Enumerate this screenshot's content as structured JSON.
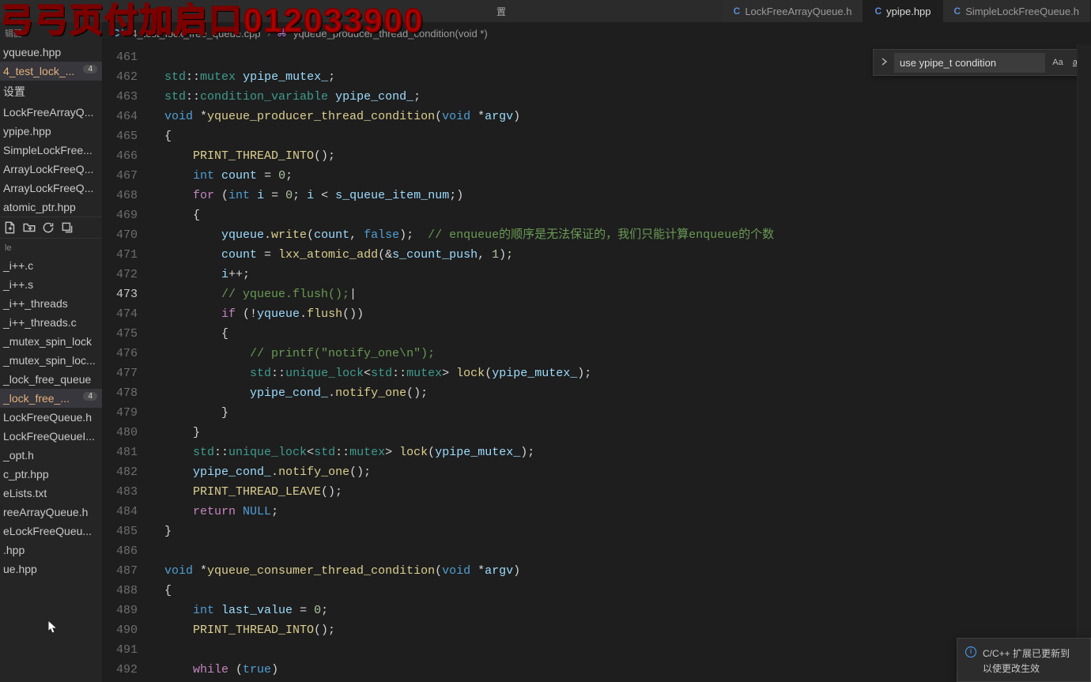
{
  "watermark": "弓弓页付加启口012033900",
  "menu": {
    "item_trimmed": "置"
  },
  "tabs": [
    {
      "lang": "C",
      "label": "LockFreeArrayQueue.h",
      "active": false
    },
    {
      "lang": "C",
      "label": "ypipe.hpp",
      "active": true
    },
    {
      "lang": "C",
      "label": "SimpleLockFreeQueue.h",
      "active": false
    }
  ],
  "breadcrumb": {
    "file_icon": "C⁺",
    "file": "4_test_lock_free_queue.cpp",
    "sep": "›",
    "sym_icon": "⌘",
    "symbol": "yqueue_producer_thread_condition(void *)"
  },
  "search": {
    "value": "use ypipe_t condition",
    "opt_case": "Aa",
    "opt_word": "ab"
  },
  "sidebar": {
    "section_open": "辑器",
    "open": [
      {
        "label": "yqueue.hpp"
      },
      {
        "label": "4_test_lock_...",
        "badge": "4",
        "active": true
      },
      {
        "label": "设置"
      },
      {
        "label": "LockFreeArrayQ..."
      },
      {
        "label": "ypipe.hpp"
      },
      {
        "label": "SimpleLockFree..."
      },
      {
        "label": "ArrayLockFreeQ..."
      },
      {
        "label": "ArrayLockFreeQ..."
      },
      {
        "label": "atomic_ptr.hpp"
      }
    ],
    "section_ws": "le",
    "ws": [
      {
        "label": "_i++.c"
      },
      {
        "label": "_i++.s"
      },
      {
        "label": "_i++_threads"
      },
      {
        "label": "_i++_threads.c"
      },
      {
        "label": "_mutex_spin_lock"
      },
      {
        "label": "_mutex_spin_loc..."
      },
      {
        "label": "_lock_free_queue"
      },
      {
        "label": "_lock_free_...",
        "badge": "4",
        "active": true
      },
      {
        "label": "LockFreeQueue.h"
      },
      {
        "label": "LockFreeQueueI..."
      },
      {
        "label": "_opt.h"
      },
      {
        "label": "c_ptr.hpp"
      },
      {
        "label": "eLists.txt"
      },
      {
        "label": "reeArrayQueue.h"
      },
      {
        "label": "eLockFreeQueu..."
      },
      {
        "label": ".hpp"
      },
      {
        "label": "ue.hpp"
      }
    ]
  },
  "gutter": {
    "start": 461,
    "end": 492,
    "current": 473
  },
  "code_lines": [
    "",
    "<span class='ty'>std</span>::<span class='ty'>mutex</span> <span class='var'>ypipe_mutex_</span>;",
    "<span class='ty'>std</span>::<span class='ty'>condition_variable</span> <span class='var'>ypipe_cond_</span>;",
    "<span class='kw'>void</span> *<span class='fn'>yqueue_producer_thread_condition</span>(<span class='kw'>void</span> *<span class='var'>argv</span>)",
    "{",
    "    <span class='fn'>PRINT_THREAD_INTO</span>();",
    "    <span class='kw'>int</span> <span class='var'>count</span> = <span class='num'>0</span>;",
    "    <span class='pp'>for</span> (<span class='kw'>int</span> <span class='var'>i</span> = <span class='num'>0</span>; <span class='var'>i</span> &lt; <span class='var'>s_queue_item_num</span>;)",
    "    {",
    "        <span class='var'>yqueue</span>.<span class='fn'>write</span>(<span class='var'>count</span>, <span class='kw'>false</span>);  <span class='cm'>// enqueue的顺序是无法保证的，我们只能计算enqueue的个数</span>",
    "        <span class='var'>count</span> = <span class='fn'>lxx_atomic_add</span>(&amp;<span class='var'>s_count_push</span>, <span class='num'>1</span>);",
    "        <span class='var'>i</span>++;",
    "        <span class='cm'>// yqueue.flush();</span>|",
    "        <span class='pp'>if</span> (!<span class='var'>yqueue</span>.<span class='fn'>flush</span>())",
    "        {",
    "            <span class='cm'>// printf(\"notify_one\\n\");</span>",
    "            <span class='ty'>std</span>::<span class='ty'>unique_lock</span>&lt;<span class='ty'>std</span>::<span class='ty'>mutex</span>&gt; <span class='fn'>lock</span>(<span class='var'>ypipe_mutex_</span>);",
    "            <span class='var'>ypipe_cond_</span>.<span class='fn'>notify_one</span>();",
    "        }",
    "    }",
    "    <span class='ty'>std</span>::<span class='ty'>unique_lock</span>&lt;<span class='ty'>std</span>::<span class='ty'>mutex</span>&gt; <span class='fn'>lock</span>(<span class='var'>ypipe_mutex_</span>);",
    "    <span class='var'>ypipe_cond_</span>.<span class='fn'>notify_one</span>();",
    "    <span class='fn'>PRINT_THREAD_LEAVE</span>();",
    "    <span class='pp'>return</span> <span class='kw'>NULL</span>;",
    "}",
    "",
    "<span class='kw'>void</span> *<span class='fn'>yqueue_consumer_thread_condition</span>(<span class='kw'>void</span> *<span class='var'>argv</span>)",
    "{",
    "    <span class='kw'>int</span> <span class='var'>last_value</span> = <span class='num'>0</span>;",
    "    <span class='fn'>PRINT_THREAD_INTO</span>();",
    "",
    "    <span class='pp'>while</span> (<span class='kw'>true</span>)"
  ],
  "toast": {
    "line1": "C/C++ 扩展已更新到",
    "line2": "以使更改生效"
  }
}
